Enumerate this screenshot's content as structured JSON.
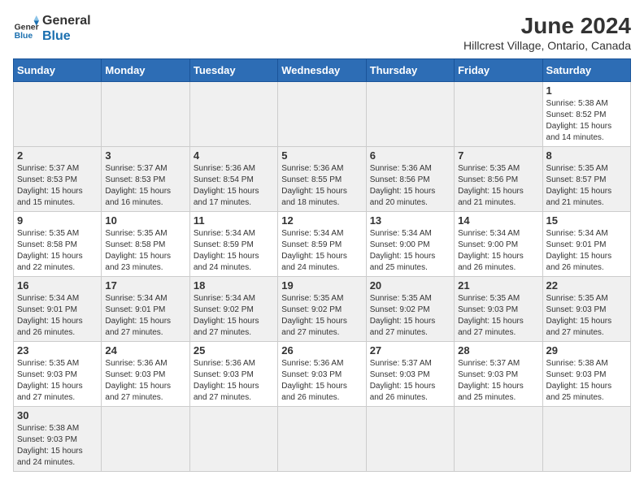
{
  "header": {
    "logo_general": "General",
    "logo_blue": "Blue",
    "month_title": "June 2024",
    "subtitle": "Hillcrest Village, Ontario, Canada"
  },
  "weekdays": [
    "Sunday",
    "Monday",
    "Tuesday",
    "Wednesday",
    "Thursday",
    "Friday",
    "Saturday"
  ],
  "weeks": [
    [
      {
        "day": "",
        "info": ""
      },
      {
        "day": "",
        "info": ""
      },
      {
        "day": "",
        "info": ""
      },
      {
        "day": "",
        "info": ""
      },
      {
        "day": "",
        "info": ""
      },
      {
        "day": "",
        "info": ""
      },
      {
        "day": "1",
        "info": "Sunrise: 5:38 AM\nSunset: 8:52 PM\nDaylight: 15 hours and 14 minutes."
      }
    ],
    [
      {
        "day": "2",
        "info": "Sunrise: 5:37 AM\nSunset: 8:53 PM\nDaylight: 15 hours and 15 minutes."
      },
      {
        "day": "3",
        "info": "Sunrise: 5:37 AM\nSunset: 8:53 PM\nDaylight: 15 hours and 16 minutes."
      },
      {
        "day": "4",
        "info": "Sunrise: 5:36 AM\nSunset: 8:54 PM\nDaylight: 15 hours and 17 minutes."
      },
      {
        "day": "5",
        "info": "Sunrise: 5:36 AM\nSunset: 8:55 PM\nDaylight: 15 hours and 18 minutes."
      },
      {
        "day": "6",
        "info": "Sunrise: 5:36 AM\nSunset: 8:56 PM\nDaylight: 15 hours and 20 minutes."
      },
      {
        "day": "7",
        "info": "Sunrise: 5:35 AM\nSunset: 8:56 PM\nDaylight: 15 hours and 21 minutes."
      },
      {
        "day": "8",
        "info": "Sunrise: 5:35 AM\nSunset: 8:57 PM\nDaylight: 15 hours and 21 minutes."
      }
    ],
    [
      {
        "day": "9",
        "info": "Sunrise: 5:35 AM\nSunset: 8:58 PM\nDaylight: 15 hours and 22 minutes."
      },
      {
        "day": "10",
        "info": "Sunrise: 5:35 AM\nSunset: 8:58 PM\nDaylight: 15 hours and 23 minutes."
      },
      {
        "day": "11",
        "info": "Sunrise: 5:34 AM\nSunset: 8:59 PM\nDaylight: 15 hours and 24 minutes."
      },
      {
        "day": "12",
        "info": "Sunrise: 5:34 AM\nSunset: 8:59 PM\nDaylight: 15 hours and 24 minutes."
      },
      {
        "day": "13",
        "info": "Sunrise: 5:34 AM\nSunset: 9:00 PM\nDaylight: 15 hours and 25 minutes."
      },
      {
        "day": "14",
        "info": "Sunrise: 5:34 AM\nSunset: 9:00 PM\nDaylight: 15 hours and 26 minutes."
      },
      {
        "day": "15",
        "info": "Sunrise: 5:34 AM\nSunset: 9:01 PM\nDaylight: 15 hours and 26 minutes."
      }
    ],
    [
      {
        "day": "16",
        "info": "Sunrise: 5:34 AM\nSunset: 9:01 PM\nDaylight: 15 hours and 26 minutes."
      },
      {
        "day": "17",
        "info": "Sunrise: 5:34 AM\nSunset: 9:01 PM\nDaylight: 15 hours and 27 minutes."
      },
      {
        "day": "18",
        "info": "Sunrise: 5:34 AM\nSunset: 9:02 PM\nDaylight: 15 hours and 27 minutes."
      },
      {
        "day": "19",
        "info": "Sunrise: 5:35 AM\nSunset: 9:02 PM\nDaylight: 15 hours and 27 minutes."
      },
      {
        "day": "20",
        "info": "Sunrise: 5:35 AM\nSunset: 9:02 PM\nDaylight: 15 hours and 27 minutes."
      },
      {
        "day": "21",
        "info": "Sunrise: 5:35 AM\nSunset: 9:03 PM\nDaylight: 15 hours and 27 minutes."
      },
      {
        "day": "22",
        "info": "Sunrise: 5:35 AM\nSunset: 9:03 PM\nDaylight: 15 hours and 27 minutes."
      }
    ],
    [
      {
        "day": "23",
        "info": "Sunrise: 5:35 AM\nSunset: 9:03 PM\nDaylight: 15 hours and 27 minutes."
      },
      {
        "day": "24",
        "info": "Sunrise: 5:36 AM\nSunset: 9:03 PM\nDaylight: 15 hours and 27 minutes."
      },
      {
        "day": "25",
        "info": "Sunrise: 5:36 AM\nSunset: 9:03 PM\nDaylight: 15 hours and 27 minutes."
      },
      {
        "day": "26",
        "info": "Sunrise: 5:36 AM\nSunset: 9:03 PM\nDaylight: 15 hours and 26 minutes."
      },
      {
        "day": "27",
        "info": "Sunrise: 5:37 AM\nSunset: 9:03 PM\nDaylight: 15 hours and 26 minutes."
      },
      {
        "day": "28",
        "info": "Sunrise: 5:37 AM\nSunset: 9:03 PM\nDaylight: 15 hours and 25 minutes."
      },
      {
        "day": "29",
        "info": "Sunrise: 5:38 AM\nSunset: 9:03 PM\nDaylight: 15 hours and 25 minutes."
      }
    ],
    [
      {
        "day": "30",
        "info": "Sunrise: 5:38 AM\nSunset: 9:03 PM\nDaylight: 15 hours and 24 minutes."
      },
      {
        "day": "",
        "info": ""
      },
      {
        "day": "",
        "info": ""
      },
      {
        "day": "",
        "info": ""
      },
      {
        "day": "",
        "info": ""
      },
      {
        "day": "",
        "info": ""
      },
      {
        "day": "",
        "info": ""
      }
    ]
  ]
}
